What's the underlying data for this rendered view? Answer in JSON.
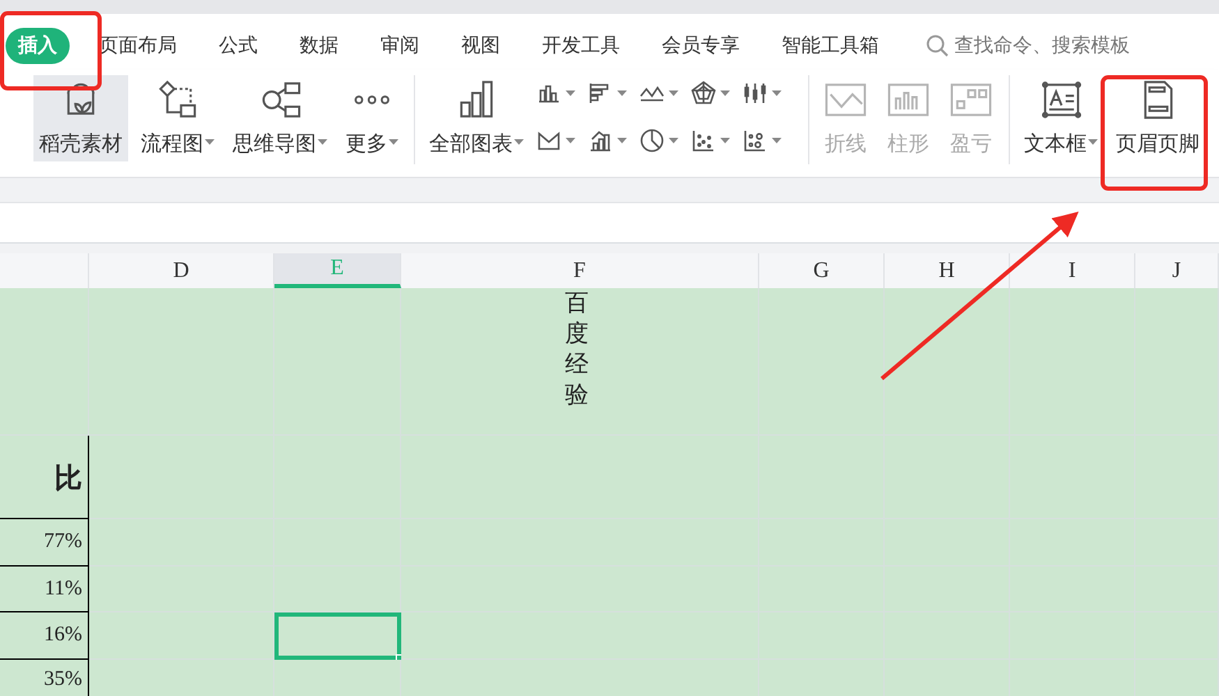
{
  "tabs": [
    {
      "label": "插入",
      "selected": true
    },
    {
      "label": "页面布局",
      "selected": false
    },
    {
      "label": "公式",
      "selected": false
    },
    {
      "label": "数据",
      "selected": false
    },
    {
      "label": "审阅",
      "selected": false
    },
    {
      "label": "视图",
      "selected": false
    },
    {
      "label": "开发工具",
      "selected": false
    },
    {
      "label": "会员专享",
      "selected": false
    },
    {
      "label": "智能工具箱",
      "selected": false
    }
  ],
  "search": {
    "placeholder": "查找命令、搜索模板"
  },
  "ribbon": {
    "groups": [
      {
        "tools": [
          {
            "kind": "large",
            "label": "稻壳素材",
            "dropdown": false,
            "highlighted": true,
            "disabled": false
          },
          {
            "kind": "large",
            "label": "流程图",
            "dropdown": true,
            "highlighted": false,
            "disabled": false
          },
          {
            "kind": "large",
            "label": "思维导图",
            "dropdown": true,
            "highlighted": false,
            "disabled": false
          },
          {
            "kind": "large",
            "label": "更多",
            "dropdown": true,
            "highlighted": false,
            "disabled": false
          }
        ]
      },
      {
        "tools": [
          {
            "kind": "large",
            "label": "全部图表",
            "dropdown": true,
            "highlighted": false,
            "disabled": false
          },
          {
            "kind": "small",
            "dropdown": true
          },
          {
            "kind": "small",
            "dropdown": true
          },
          {
            "kind": "small",
            "dropdown": true
          },
          {
            "kind": "small",
            "dropdown": true
          },
          {
            "kind": "small",
            "dropdown": true
          },
          {
            "kind": "small",
            "dropdown": true
          },
          {
            "kind": "small",
            "dropdown": true
          },
          {
            "kind": "small",
            "dropdown": true
          },
          {
            "kind": "small",
            "dropdown": true
          },
          {
            "kind": "small",
            "dropdown": true
          }
        ]
      },
      {
        "tools": [
          {
            "kind": "large",
            "label": "折线",
            "dropdown": false,
            "highlighted": false,
            "disabled": true
          },
          {
            "kind": "large",
            "label": "柱形",
            "dropdown": false,
            "highlighted": false,
            "disabled": true
          },
          {
            "kind": "large",
            "label": "盈亏",
            "dropdown": false,
            "highlighted": false,
            "disabled": true
          }
        ]
      },
      {
        "tools": [
          {
            "kind": "large",
            "label": "文本框",
            "dropdown": true,
            "highlighted": false,
            "disabled": false
          },
          {
            "kind": "large",
            "label": "页眉页脚",
            "dropdown": false,
            "highlighted": false,
            "disabled": false
          }
        ]
      }
    ]
  },
  "sheet": {
    "column_headers": [
      {
        "label": "D",
        "selected": false
      },
      {
        "label": "E",
        "selected": true
      },
      {
        "label": "F",
        "selected": false
      },
      {
        "label": "G",
        "selected": false
      },
      {
        "label": "H",
        "selected": false
      },
      {
        "label": "I",
        "selected": false
      },
      {
        "label": "J",
        "selected": false
      }
    ],
    "rows": [
      {
        "partial_column": null,
        "cells": [
          null,
          null,
          "百度经验",
          null,
          null,
          null,
          null
        ],
        "active": false
      },
      {
        "partial_column": "比",
        "cells": [
          null,
          null,
          null,
          null,
          null,
          null,
          null
        ],
        "active": false
      },
      {
        "partial_column": "77%",
        "cells": [
          null,
          null,
          null,
          null,
          null,
          null,
          null
        ],
        "active": false
      },
      {
        "partial_column": "11%",
        "cells": [
          null,
          null,
          null,
          null,
          null,
          null,
          null
        ],
        "active": false
      },
      {
        "partial_column": "16%",
        "cells": [
          null,
          null,
          null,
          null,
          null,
          null,
          null
        ],
        "active": true
      },
      {
        "partial_column": "35%",
        "cells": [
          null,
          null,
          null,
          null,
          null,
          null,
          null
        ],
        "active": false
      }
    ]
  }
}
